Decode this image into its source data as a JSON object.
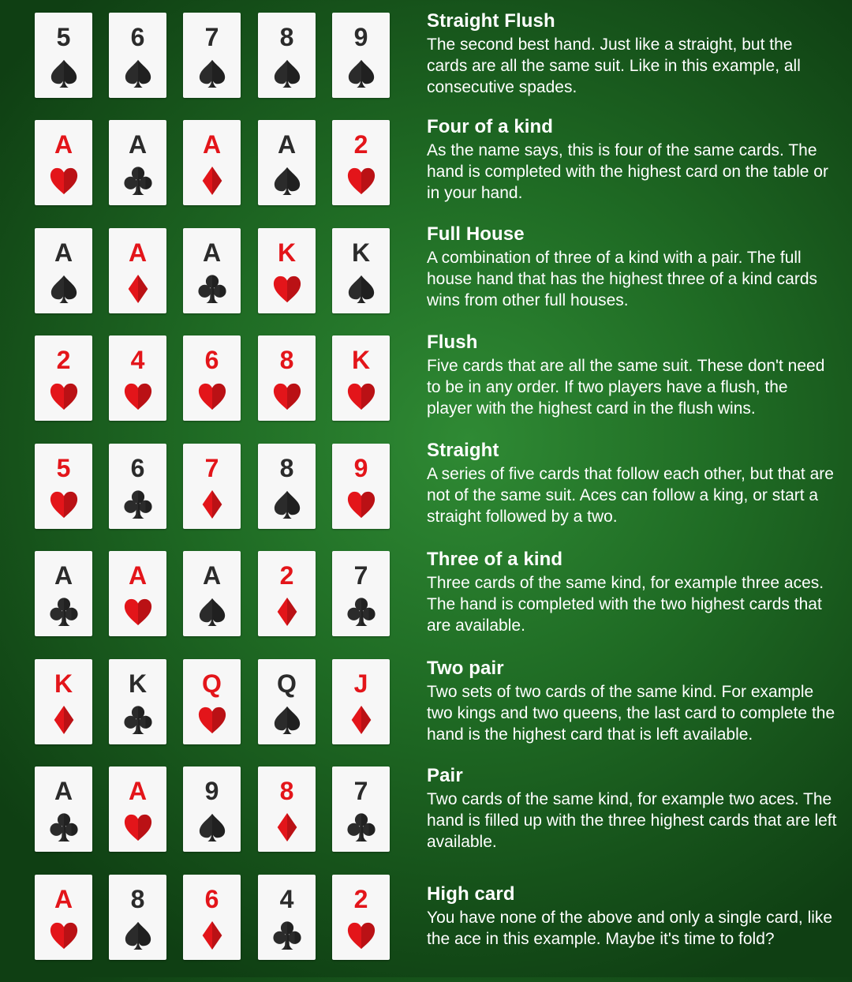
{
  "colors": {
    "background": "#1f6b24",
    "card": "#f7f7f7",
    "red_suit": "#e3151a",
    "black_suit": "#2b2b2b",
    "text": "#ffffff"
  },
  "hands": [
    {
      "title": "Straight Flush",
      "description": "The second best hand. Just like a straight, but the cards are all the same suit. Like in this example, all consecutive spades.",
      "cards": [
        {
          "rank": "5",
          "suit": "spade"
        },
        {
          "rank": "6",
          "suit": "spade"
        },
        {
          "rank": "7",
          "suit": "spade"
        },
        {
          "rank": "8",
          "suit": "spade"
        },
        {
          "rank": "9",
          "suit": "spade"
        }
      ]
    },
    {
      "title": "Four of a kind",
      "description": "As the name says, this is four of the same cards. The hand is completed with the highest card on the table or in your hand.",
      "cards": [
        {
          "rank": "A",
          "suit": "heart"
        },
        {
          "rank": "A",
          "suit": "club"
        },
        {
          "rank": "A",
          "suit": "diamond"
        },
        {
          "rank": "A",
          "suit": "spade"
        },
        {
          "rank": "2",
          "suit": "heart"
        }
      ]
    },
    {
      "title": "Full House",
      "description": "A combination of three of a kind with a pair. The full house hand that has the highest three of a kind cards wins from other full houses.",
      "cards": [
        {
          "rank": "A",
          "suit": "spade"
        },
        {
          "rank": "A",
          "suit": "diamond"
        },
        {
          "rank": "A",
          "suit": "club"
        },
        {
          "rank": "K",
          "suit": "heart"
        },
        {
          "rank": "K",
          "suit": "spade"
        }
      ]
    },
    {
      "title": "Flush",
      "description": "Five cards that are all the same suit. These don't need to be in any order. If two players have a flush, the player with the highest card in the flush wins.",
      "cards": [
        {
          "rank": "2",
          "suit": "heart"
        },
        {
          "rank": "4",
          "suit": "heart"
        },
        {
          "rank": "6",
          "suit": "heart"
        },
        {
          "rank": "8",
          "suit": "heart"
        },
        {
          "rank": "K",
          "suit": "heart"
        }
      ]
    },
    {
      "title": "Straight",
      "description": "A series of five cards that follow each other, but that are not of the same suit. Aces can follow a king, or start a straight followed by a two.",
      "cards": [
        {
          "rank": "5",
          "suit": "heart"
        },
        {
          "rank": "6",
          "suit": "club"
        },
        {
          "rank": "7",
          "suit": "diamond"
        },
        {
          "rank": "8",
          "suit": "spade"
        },
        {
          "rank": "9",
          "suit": "heart"
        }
      ]
    },
    {
      "title": "Three of a kind",
      "description": "Three cards of the same kind, for example three aces. The hand is completed with the two highest cards that are available.",
      "cards": [
        {
          "rank": "A",
          "suit": "club"
        },
        {
          "rank": "A",
          "suit": "heart"
        },
        {
          "rank": "A",
          "suit": "spade"
        },
        {
          "rank": "2",
          "suit": "diamond"
        },
        {
          "rank": "7",
          "suit": "club"
        }
      ]
    },
    {
      "title": "Two pair",
      "description": "Two sets of two cards of the same kind. For example two kings and two queens, the last card to complete the hand is the highest card that is left available.",
      "cards": [
        {
          "rank": "K",
          "suit": "diamond"
        },
        {
          "rank": "K",
          "suit": "club"
        },
        {
          "rank": "Q",
          "suit": "heart"
        },
        {
          "rank": "Q",
          "suit": "spade"
        },
        {
          "rank": "J",
          "suit": "diamond"
        }
      ]
    },
    {
      "title": "Pair",
      "description": "Two cards of the same kind, for example two aces. The hand is filled up with the three highest cards that are left available.",
      "cards": [
        {
          "rank": "A",
          "suit": "club"
        },
        {
          "rank": "A",
          "suit": "heart"
        },
        {
          "rank": "9",
          "suit": "spade"
        },
        {
          "rank": "8",
          "suit": "diamond"
        },
        {
          "rank": "7",
          "suit": "club"
        }
      ]
    },
    {
      "title": "High card",
      "description": "You have none of the above and only a single card, like the ace in this example. Maybe it's time to fold?",
      "cards": [
        {
          "rank": "A",
          "suit": "heart"
        },
        {
          "rank": "8",
          "suit": "spade"
        },
        {
          "rank": "6",
          "suit": "diamond"
        },
        {
          "rank": "4",
          "suit": "club"
        },
        {
          "rank": "2",
          "suit": "heart"
        }
      ]
    }
  ]
}
